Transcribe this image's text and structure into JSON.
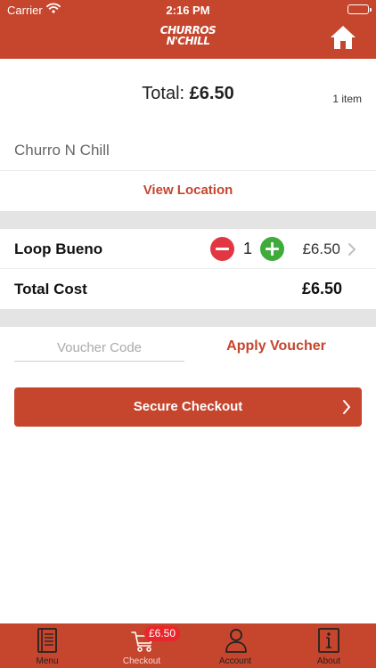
{
  "status_bar": {
    "carrier": "Carrier",
    "time": "2:16 PM"
  },
  "header": {
    "logo_line1": "CHURROS",
    "logo_line2": "N'CHILL",
    "home_icon": "home-icon"
  },
  "summary": {
    "total_label": "Total:",
    "total_amount": "£6.50",
    "item_count": "1 item"
  },
  "store": {
    "name": "Churro N Chill",
    "view_location_label": "View Location"
  },
  "cart": {
    "items": [
      {
        "name": "Loop Bueno",
        "quantity": "1",
        "price": "£6.50"
      }
    ],
    "total_cost_label": "Total Cost",
    "total_cost_value": "£6.50"
  },
  "voucher": {
    "placeholder": "Voucher Code",
    "value": "",
    "apply_label": "Apply Voucher"
  },
  "checkout": {
    "label": "Secure Checkout"
  },
  "tabs": [
    {
      "label": "Menu",
      "icon": "book-icon"
    },
    {
      "label": "Checkout",
      "icon": "cart-icon",
      "badge": "£6.50"
    },
    {
      "label": "Account",
      "icon": "user-icon"
    },
    {
      "label": "About",
      "icon": "info-icon"
    }
  ],
  "colors": {
    "brand": "#c5452d",
    "minus": "#e23743",
    "plus": "#3fab3a",
    "badge": "#e8262b",
    "separator": "#e4e4e4"
  }
}
